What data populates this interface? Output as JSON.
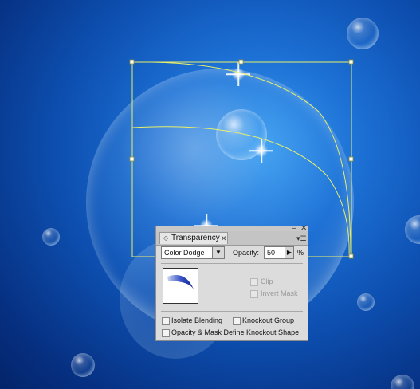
{
  "panel": {
    "title": "Transparency",
    "tab_arrows": "◇",
    "tab_close": "✕",
    "minimize_glyph": "‒",
    "close_glyph": "✕",
    "menu_glyph": "▾☰",
    "blend_mode": "Color Dodge",
    "dropdown_arrow": "▼",
    "opacity_label": "Opacity:",
    "opacity_value": "50",
    "opacity_step_arrow": "▶",
    "percent_sign": "%",
    "clip_label": "Clip",
    "invert_mask_label": "Invert Mask",
    "isolate_blending_label": "Isolate Blending",
    "knockout_group_label": "Knockout Group",
    "opacity_mask_label": "Opacity & Mask Define Knockout Shape"
  },
  "colors": {
    "background_blue": "#0d4fb0",
    "selection_yellow": "#e8f06a",
    "panel_gray": "#dcdcdc"
  },
  "icons": {
    "thumbnail": "crescent-brush-thumbnail-icon",
    "sparkle": "star-sparkle-icon"
  }
}
